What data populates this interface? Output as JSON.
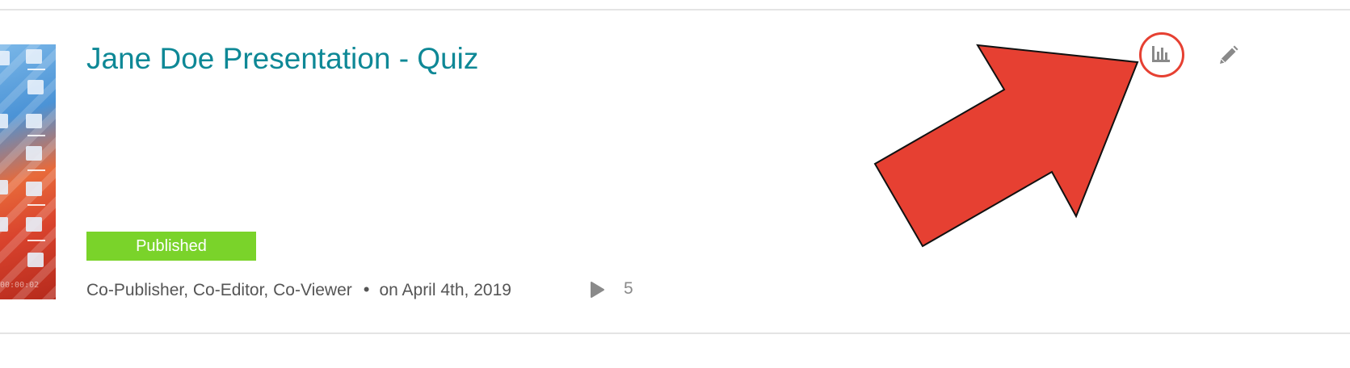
{
  "item": {
    "title": "Jane Doe Presentation - Quiz",
    "status": "Published",
    "roles": "Co-Publisher, Co-Editor, Co-Viewer",
    "separator": "•",
    "date": "on April 4th, 2019",
    "play_count": "5",
    "thumbnail_time": "00:00:02"
  },
  "icons": {
    "play": "play-icon",
    "analytics": "bar-chart-icon",
    "edit": "pencil-icon",
    "callout": "arrow-callout"
  },
  "colors": {
    "title": "#0e8896",
    "badge": "#7ad32a",
    "callout": "#e64032",
    "meta_text": "#555555"
  }
}
